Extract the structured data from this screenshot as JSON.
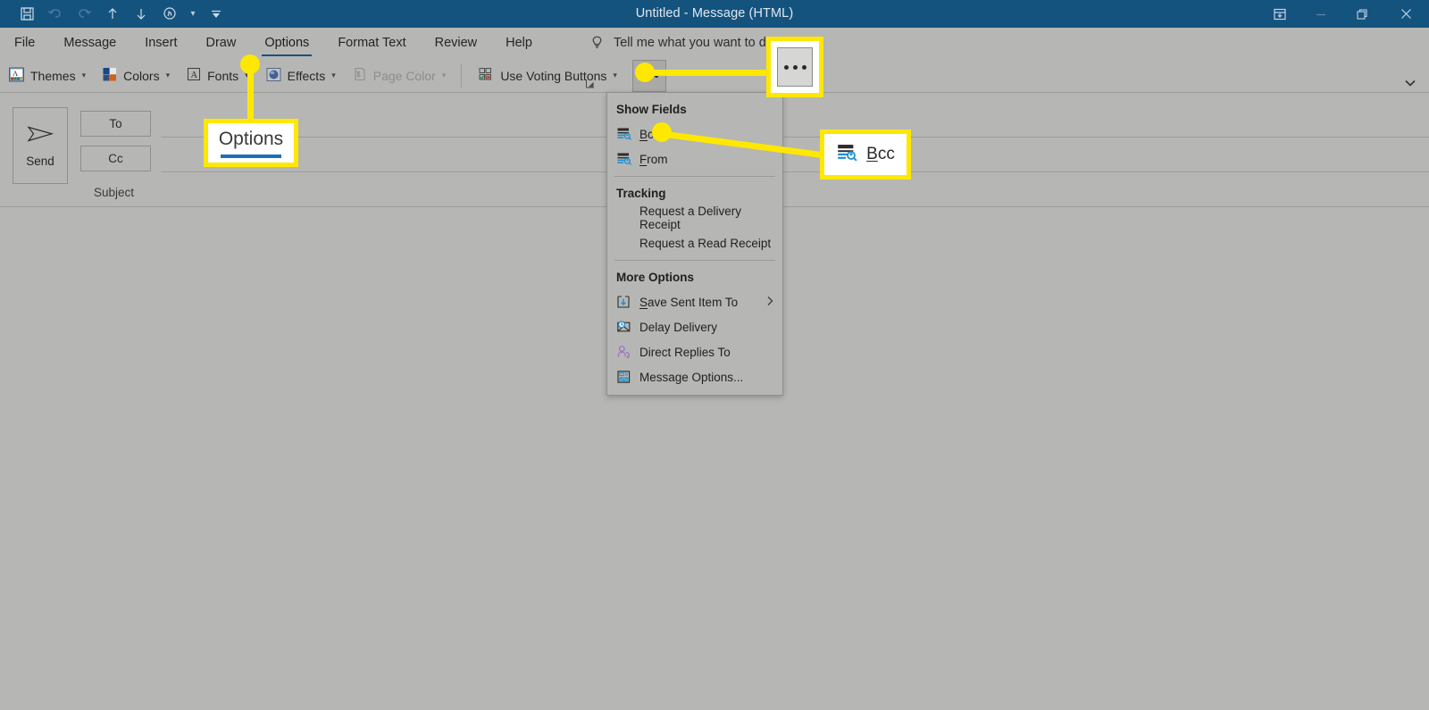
{
  "window": {
    "title": "Untitled  -  Message (HTML)",
    "theme_color": "#15537f",
    "chrome_color": "#b6b6b4",
    "accent_yellow": "#ffe800"
  },
  "quick_access": [
    {
      "name": "save-icon",
      "label": "Save",
      "enabled": true
    },
    {
      "name": "undo-icon",
      "label": "Undo",
      "enabled": false
    },
    {
      "name": "redo-icon",
      "label": "Redo",
      "enabled": false
    },
    {
      "name": "previous-item-icon",
      "label": "Previous Item",
      "enabled": true
    },
    {
      "name": "next-item-icon",
      "label": "Next Item",
      "enabled": true
    },
    {
      "name": "touch-mode-icon",
      "label": "Touch/Mouse Mode",
      "enabled": true
    }
  ],
  "window_controls": [
    {
      "name": "ribbon-display-options-icon",
      "label": "Ribbon Display Options"
    },
    {
      "name": "minimize-icon",
      "label": "Minimize"
    },
    {
      "name": "maximize-icon",
      "label": "Restore Down"
    },
    {
      "name": "close-icon",
      "label": "Close"
    }
  ],
  "tabs": [
    {
      "label": "File",
      "active": false
    },
    {
      "label": "Message",
      "active": false
    },
    {
      "label": "Insert",
      "active": false
    },
    {
      "label": "Draw",
      "active": false
    },
    {
      "label": "Options",
      "active": true
    },
    {
      "label": "Format Text",
      "active": false
    },
    {
      "label": "Review",
      "active": false
    },
    {
      "label": "Help",
      "active": false
    }
  ],
  "tell_me": {
    "icon": "lightbulb-icon",
    "placeholder": "Tell me what you want to do"
  },
  "ribbon": {
    "items": [
      {
        "label": "Themes",
        "icon": "themes-icon",
        "has_caret": true,
        "disabled": false
      },
      {
        "label": "Colors",
        "icon": "colors-icon",
        "has_caret": true,
        "disabled": false
      },
      {
        "label": "Fonts",
        "icon": "fonts-icon",
        "has_caret": true,
        "disabled": false
      },
      {
        "label": "Effects",
        "icon": "effects-icon",
        "has_caret": true,
        "disabled": false
      },
      {
        "label": "Page Color",
        "icon": "page-color-icon",
        "has_caret": true,
        "disabled": true
      },
      {
        "label": "Use Voting Buttons",
        "icon": "voting-buttons-icon",
        "has_caret": true,
        "disabled": false
      }
    ],
    "overflow_button": "more-commands-ellipsis",
    "dialog_launcher": "themes-dialog-launcher",
    "collapse_button": "collapse-ribbon-chevron"
  },
  "compose": {
    "send_label": "Send",
    "to_label": "To",
    "cc_label": "Cc",
    "subject_label": "Subject"
  },
  "menu": {
    "sections": [
      {
        "heading": "Show Fields",
        "items": [
          {
            "label": "Bcc",
            "icon": "bcc-field-icon",
            "accel": "B",
            "submenu": false
          },
          {
            "label": "From",
            "icon": "from-field-icon",
            "accel": "F",
            "submenu": false
          }
        ]
      },
      {
        "heading": "Tracking",
        "items": [
          {
            "label": "Request a Delivery Receipt",
            "icon": null,
            "accel": null,
            "submenu": false
          },
          {
            "label": "Request a Read Receipt",
            "icon": null,
            "accel": null,
            "submenu": false
          }
        ]
      },
      {
        "heading": "More Options",
        "items": [
          {
            "label": "Save Sent Item To",
            "icon": "save-sent-item-icon",
            "accel": "S",
            "submenu": true
          },
          {
            "label": "Delay Delivery",
            "icon": "delay-delivery-icon",
            "accel": null,
            "submenu": false
          },
          {
            "label": "Direct Replies To",
            "icon": "direct-replies-icon",
            "accel": null,
            "submenu": false
          },
          {
            "label": "Message Options...",
            "icon": "message-options-icon",
            "accel": null,
            "submenu": false
          }
        ]
      }
    ]
  },
  "annotations": [
    {
      "name": "options-tab-callout",
      "text": "Options",
      "has_underline": true,
      "underline_color": "#1d6fb8"
    },
    {
      "name": "ellipsis-button-callout",
      "text": "",
      "icon": "more-commands-ellipsis"
    },
    {
      "name": "bcc-menu-item-callout",
      "text": "Bcc",
      "icon": "bcc-field-icon"
    }
  ]
}
